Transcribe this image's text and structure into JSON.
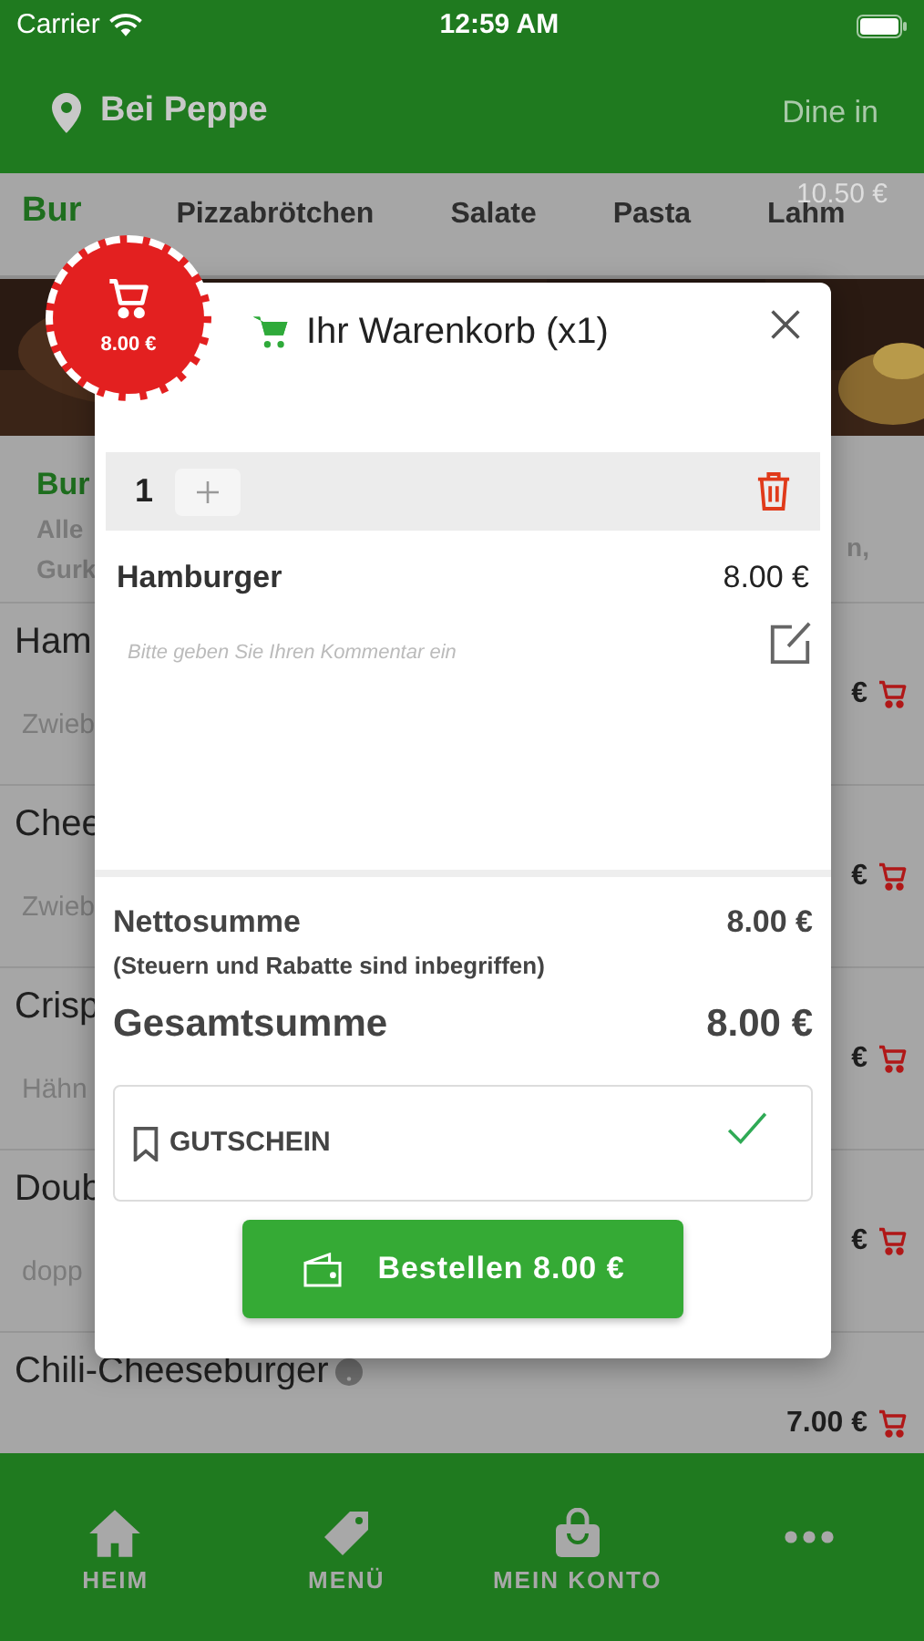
{
  "status_bar": {
    "carrier": "Carrier",
    "time": "12:59 AM"
  },
  "header": {
    "restaurant": "Bei Peppe",
    "mode": "Dine in"
  },
  "category_tabs": [
    {
      "label": "Bur",
      "selected": true
    },
    {
      "label": "Pizzabrötchen",
      "selected": false
    },
    {
      "label": "Salate",
      "selected": false
    },
    {
      "label": "Pasta",
      "selected": false
    },
    {
      "label": "Lahm",
      "selected": false
    }
  ],
  "cart_total_hint": "10.50 €",
  "category": {
    "title": "Bur",
    "description_lines": [
      "Alle",
      "Gurk"
    ],
    "description_end": "n,"
  },
  "menu_items": [
    {
      "name": "Ham",
      "description": "Zwieb",
      "price": "€"
    },
    {
      "name": "Chee",
      "description": "Zwieb",
      "price": "€"
    },
    {
      "name": "Crisp",
      "description": "Hähn",
      "price": "€"
    },
    {
      "name": "Doub",
      "description": "dopp",
      "price": "€"
    },
    {
      "name": "Chili-Cheeseburger",
      "info": true,
      "price": "7.00 €"
    }
  ],
  "cart_badge": {
    "total": "8.00 €"
  },
  "cart_dialog": {
    "title": "Ihr Warenkorb (x1)",
    "items": [
      {
        "quantity": "1",
        "name": "Hamburger",
        "price": "8.00 €",
        "comment_placeholder": "Bitte geben Sie Ihren Kommentar ein"
      }
    ],
    "net_label": "Nettosumme",
    "net_value": "8.00 €",
    "net_note": "(Steuern und Rabatte sind inbegriffen)",
    "total_label": "Gesamtsumme",
    "total_value": "8.00 €",
    "voucher": {
      "label": "GUTSCHEIN",
      "applied": true
    },
    "order_button": "Bestellen 8.00 €"
  },
  "bottom_nav": [
    {
      "kind": "home",
      "label": "HEIM"
    },
    {
      "kind": "tag",
      "label": "MENÜ"
    },
    {
      "kind": "bag",
      "label": "MEIN KONTO"
    },
    {
      "kind": "more"
    }
  ]
}
